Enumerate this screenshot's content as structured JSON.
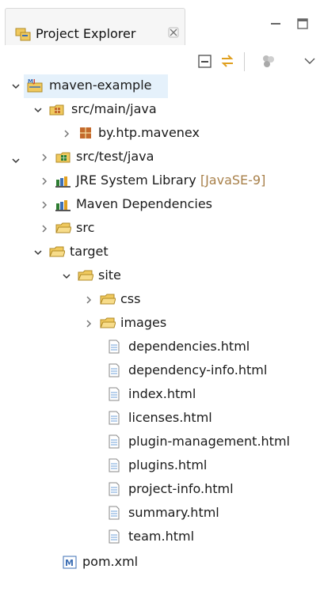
{
  "tab": {
    "title": "Project Explorer"
  },
  "tree": {
    "project": "maven-example",
    "src_main_java": "src/main/java",
    "package": "by.htp.mavenex",
    "src_test_java": "src/test/java",
    "jre_label": "JRE System Library",
    "jre_decoration": "[JavaSE-9]",
    "maven_deps": "Maven Dependencies",
    "src": "src",
    "target": "target",
    "site": "site",
    "css": "css",
    "images": "images",
    "files": [
      "dependencies.html",
      "dependency-info.html",
      "index.html",
      "licenses.html",
      "plugin-management.html",
      "plugins.html",
      "project-info.html",
      "summary.html",
      "team.html"
    ],
    "pom": "pom.xml"
  },
  "colors": {
    "folder": "#e8c35a",
    "package_src": "#c9a53e",
    "library": "#2e7d32",
    "accent_blue": "#3d6fb4"
  }
}
